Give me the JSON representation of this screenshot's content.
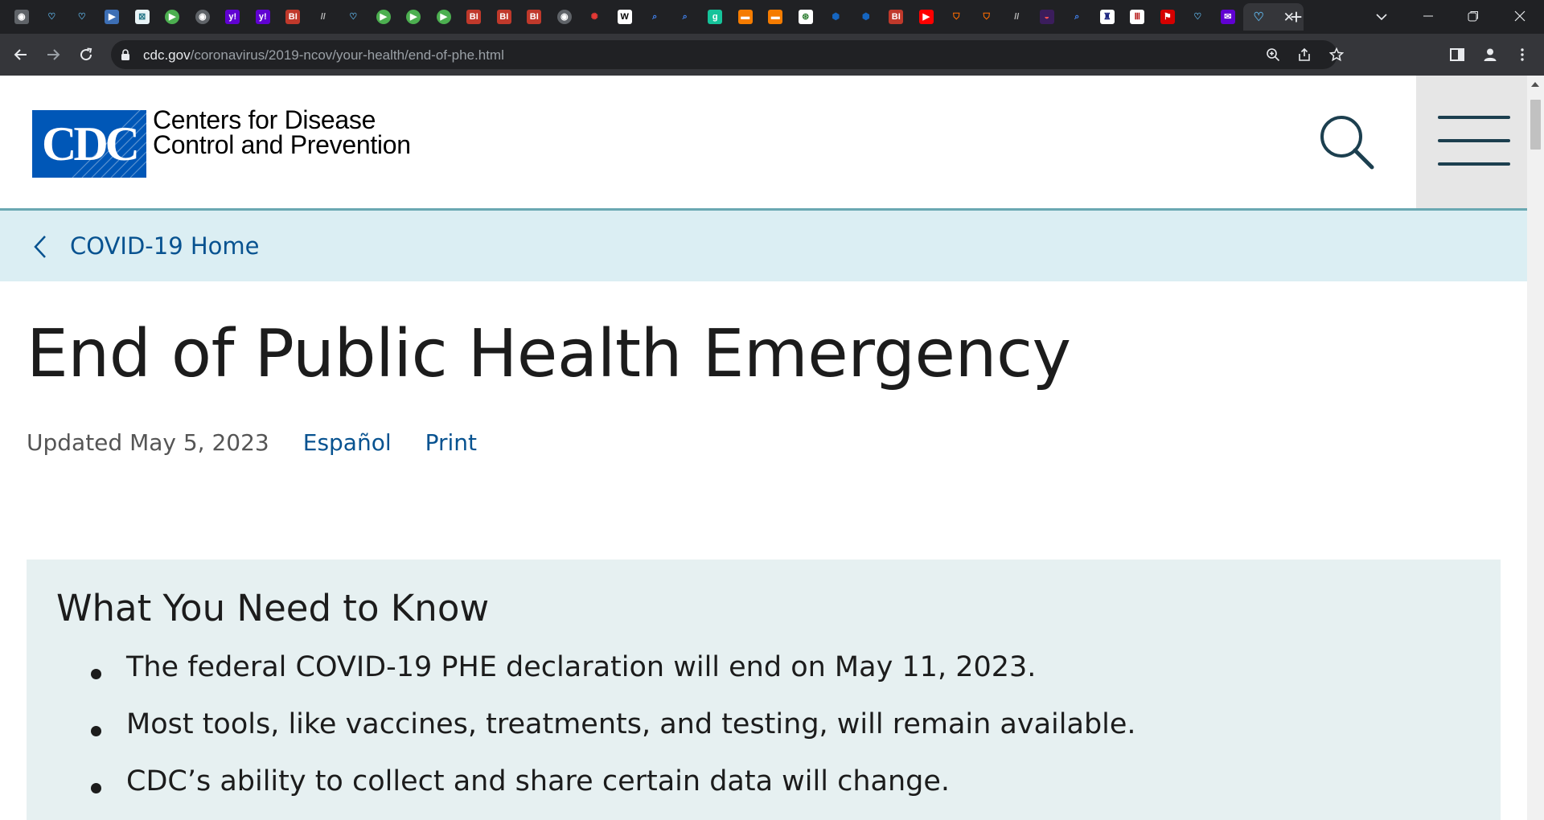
{
  "browser": {
    "tabs": [
      {
        "icon": "globe-icon",
        "bg": "#5f6368",
        "glyph": "◉"
      },
      {
        "icon": "heart-icon",
        "bg": "#202124",
        "glyph": "♡",
        "color": "#5aa7d6"
      },
      {
        "icon": "heart-icon",
        "bg": "#202124",
        "glyph": "♡",
        "color": "#5aa7d6"
      },
      {
        "icon": "folder-icon",
        "bg": "#3d6fb5",
        "glyph": "▶"
      },
      {
        "icon": "grid-icon",
        "bg": "#e8f3f6",
        "glyph": "⊠",
        "color": "#2a7a8a"
      },
      {
        "icon": "play-icon",
        "bg": "#4caf50",
        "glyph": "▶",
        "circle": true
      },
      {
        "icon": "globe-icon",
        "bg": "#5f6368",
        "glyph": "◉",
        "circle": true
      },
      {
        "icon": "yahoo-icon",
        "bg": "#6001d2",
        "glyph": "y!"
      },
      {
        "icon": "yahoo-icon",
        "bg": "#6001d2",
        "glyph": "y!"
      },
      {
        "icon": "business-insider-icon",
        "bg": "#c0392b",
        "glyph": "BI"
      },
      {
        "icon": "slash-icon",
        "bg": "#202124",
        "glyph": "//",
        "color": "#bdbdbd"
      },
      {
        "icon": "heart-icon",
        "bg": "#202124",
        "glyph": "♡",
        "color": "#5aa7d6"
      },
      {
        "icon": "play-icon",
        "bg": "#4caf50",
        "glyph": "▶",
        "circle": true
      },
      {
        "icon": "play-icon",
        "bg": "#4caf50",
        "glyph": "▶",
        "circle": true
      },
      {
        "icon": "play-icon",
        "bg": "#4caf50",
        "glyph": "▶",
        "circle": true
      },
      {
        "icon": "business-insider-icon",
        "bg": "#c0392b",
        "glyph": "BI"
      },
      {
        "icon": "business-insider-icon",
        "bg": "#c0392b",
        "glyph": "BI"
      },
      {
        "icon": "business-insider-icon",
        "bg": "#c0392b",
        "glyph": "BI"
      },
      {
        "icon": "globe-icon",
        "bg": "#5f6368",
        "glyph": "◉",
        "circle": true
      },
      {
        "icon": "burst-icon",
        "bg": "#202124",
        "glyph": "✺",
        "color": "#e53935"
      },
      {
        "icon": "news-icon",
        "bg": "#ffffff",
        "glyph": "W",
        "color": "#000"
      },
      {
        "icon": "search-icon",
        "bg": "#202124",
        "glyph": "⌕",
        "color": "#4285f4"
      },
      {
        "icon": "search-icon",
        "bg": "#202124",
        "glyph": "⌕",
        "color": "#4285f4"
      },
      {
        "icon": "grammarly-g-icon",
        "bg": "#15c39a",
        "glyph": "g"
      },
      {
        "icon": "bookmark-icon",
        "bg": "#f57c00",
        "glyph": "▬"
      },
      {
        "icon": "bookmark-icon",
        "bg": "#f57c00",
        "glyph": "▬"
      },
      {
        "icon": "seal-icon",
        "bg": "#ffffff",
        "glyph": "⊛",
        "color": "#2e7d32"
      },
      {
        "icon": "cube-icon",
        "bg": "#202124",
        "glyph": "⬢",
        "color": "#1565c0"
      },
      {
        "icon": "cube-icon",
        "bg": "#202124",
        "glyph": "⬢",
        "color": "#1565c0"
      },
      {
        "icon": "business-insider-icon",
        "bg": "#c0392b",
        "glyph": "BI"
      },
      {
        "icon": "youtube-icon",
        "bg": "#ff0000",
        "glyph": "▶"
      },
      {
        "icon": "shield-icon",
        "bg": "#202124",
        "glyph": "⛉",
        "color": "#ff6d00"
      },
      {
        "icon": "shield-icon",
        "bg": "#202124",
        "glyph": "⛉",
        "color": "#ff6d00"
      },
      {
        "icon": "slash-icon",
        "bg": "#202124",
        "glyph": "//",
        "color": "#bdbdbd"
      },
      {
        "icon": "mask-icon",
        "bg": "#3b1d5c",
        "glyph": "◒",
        "color": "#ff5252"
      },
      {
        "icon": "search-icon",
        "bg": "#202124",
        "glyph": "⌕",
        "color": "#4285f4"
      },
      {
        "icon": "crest-icon",
        "bg": "#ffffff",
        "glyph": "♜",
        "color": "#1a237e"
      },
      {
        "icon": "columns-icon",
        "bg": "#ffffff",
        "glyph": "Ⅲ",
        "color": "#b71c1c"
      },
      {
        "icon": "flag-icon",
        "bg": "#d50000",
        "glyph": "⚑"
      },
      {
        "icon": "heart-icon",
        "bg": "#202124",
        "glyph": "♡",
        "color": "#5aa7d6"
      },
      {
        "icon": "yahoo-mail-icon",
        "bg": "#6001d2",
        "glyph": "✉"
      }
    ],
    "active_tab": {
      "icon": "heart-icon",
      "glyph": "♡",
      "color": "#5aa7d6",
      "close": "✕"
    },
    "new_tab": "+",
    "url_host": "cdc.gov",
    "url_path": "/coronavirus/2019-ncov/your-health/end-of-phe.html"
  },
  "site": {
    "logo_text": "CDC",
    "org_line1": "Centers for Disease",
    "org_line2": "Control and Prevention",
    "brand_color": "#0057b7",
    "accent_color": "#6aa8b2"
  },
  "breadcrumb": {
    "label": "COVID-19 Home"
  },
  "page": {
    "title": "End of Public Health Emergency",
    "updated": "Updated May 5, 2023",
    "espanol": "Español",
    "print": "Print"
  },
  "need_to_know": {
    "heading": "What You Need to Know",
    "items": [
      "The federal COVID-19 PHE declaration will end on May 11, 2023.",
      "Most tools, like vaccines, treatments, and testing, will remain available.",
      "CDC’s ability to collect and share certain data will change."
    ]
  }
}
